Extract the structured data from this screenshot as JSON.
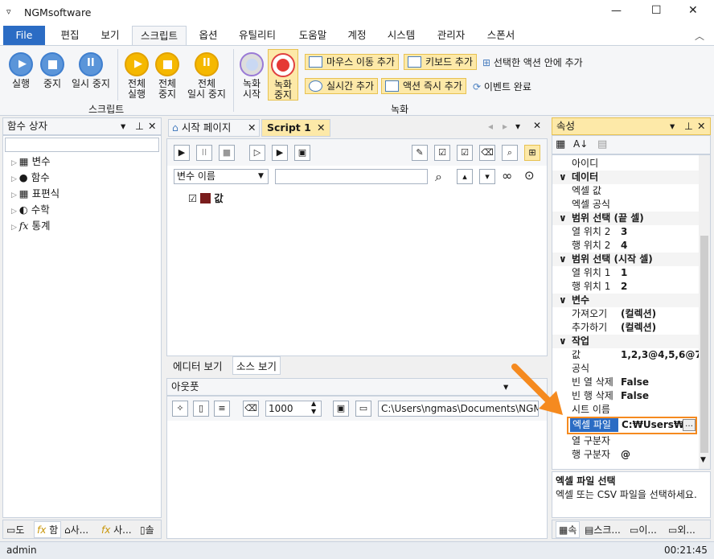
{
  "window": {
    "title": "NGMsoftware",
    "minimize": "—",
    "maximize": "☐",
    "close": "✕"
  },
  "menu": {
    "file": "File",
    "tabs": [
      "편집",
      "보기",
      "스크립트",
      "옵션",
      "유틸리티",
      "도움말",
      "계정",
      "시스템",
      "관리자",
      "스폰서"
    ]
  },
  "ribbon": {
    "script_group": "스크립트",
    "record_group": "녹화",
    "run": "실행",
    "stop": "중지",
    "pause": "일시 중지",
    "run_all_1": "전체",
    "run_all_2": "실행",
    "stop_all_1": "전체",
    "stop_all_2": "중지",
    "pause_all_1": "전체",
    "pause_all_2": "일시 중지",
    "rec_start_1": "녹화",
    "rec_start_2": "시작",
    "rec_stop_1": "녹화",
    "rec_stop_2": "중지",
    "add_mouse_move": "마우스 이동 추가",
    "add_keyboard": "키보드 추가",
    "inside_selected_action": "선택한 액션 안에 추가",
    "add_realtime": "실시간 추가",
    "add_action_immediate": "액션 즉시 추가",
    "event_complete": "이벤트 완료"
  },
  "toolbox": {
    "title": "함수 상자",
    "search": "",
    "items": [
      "변수",
      "함수",
      "표편식",
      "수학",
      "통계"
    ],
    "bottom_tabs": [
      "도",
      "함",
      "사...",
      "사...",
      "솔"
    ]
  },
  "editor": {
    "tabs": [
      "시작 페이지",
      "Script 1"
    ],
    "var_combo": "변수 이름",
    "var_search": "",
    "node_label": "값",
    "view_tabs": [
      "에디터 보기",
      "소스 보기"
    ]
  },
  "output": {
    "title": "아웃풋",
    "count": "1000",
    "path": "C:\\Users\\ngmas\\Documents\\NGM6\\"
  },
  "properties": {
    "title": "속성",
    "rows": [
      {
        "k": "아이디",
        "v": ""
      },
      {
        "cat": "데이터"
      },
      {
        "k": "엑셀 값",
        "v": ""
      },
      {
        "k": "엑셀 공식",
        "v": ""
      },
      {
        "cat": "범위 선택 (끝 셀)"
      },
      {
        "k": "열 위치 2",
        "v": "3"
      },
      {
        "k": "행 위치 2",
        "v": "4"
      },
      {
        "cat": "범위 선택 (시작 셀)"
      },
      {
        "k": "열 위치 1",
        "v": "1"
      },
      {
        "k": "행 위치 1",
        "v": "2"
      },
      {
        "cat": "변수"
      },
      {
        "k": "가져오기",
        "v": "(컬렉션)"
      },
      {
        "k": "추가하기",
        "v": "(컬렉션)"
      },
      {
        "cat": "작업"
      },
      {
        "k": "값",
        "v": "1,2,3@4,5,6@7"
      },
      {
        "k": "공식",
        "v": ""
      },
      {
        "k": "빈 열 삭제",
        "v": "False"
      },
      {
        "k": "빈 행 삭제",
        "v": "False"
      },
      {
        "k": "시트 이름",
        "v": ""
      },
      {
        "k": "엑셀 파일",
        "v": "C:₩Users₩"
      },
      {
        "k": "열 구분자",
        "v": ""
      },
      {
        "k": "행 구분자",
        "v": "@"
      }
    ],
    "desc_title": "엑셀 파일 선택",
    "desc_text": "엑셀 또는 CSV 파일을 선택하세요.",
    "bottom_tabs": [
      "속",
      "스크...",
      "이...",
      "외..."
    ]
  },
  "status": {
    "user": "admin",
    "time": "00:21:45"
  }
}
